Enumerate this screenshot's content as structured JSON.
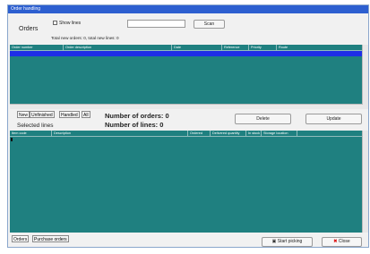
{
  "window": {
    "title": "Order handling"
  },
  "orders": {
    "heading": "Orders",
    "show_lines_label": "Show lines",
    "scan_label": "Scan",
    "summary": "Total new orders: 0, total new lines: 0",
    "columns": [
      "Order number",
      "Order description",
      "Date",
      "Reference",
      "Priority",
      "Route"
    ]
  },
  "filter_tabs": [
    "New",
    "Unfinished",
    "Handled",
    "All"
  ],
  "stats": {
    "orders_text": "Number of orders: 0",
    "lines_text": "Number of lines: 0"
  },
  "actions": {
    "delete_label": "Delete",
    "update_label": "Update"
  },
  "lines": {
    "heading": "Selected lines",
    "columns": [
      "Item code",
      "Description",
      "Ordered",
      "Delivered quantity",
      "In stock",
      "Storage location"
    ]
  },
  "bottom_tabs": [
    "Orders",
    "Purchase orders"
  ],
  "footer": {
    "start_picking_label": "Start picking",
    "close_label": "Close"
  },
  "colors": {
    "grid": "#1f8080",
    "selection": "#1e2ee6",
    "titlebar": "#2d5fd0"
  }
}
